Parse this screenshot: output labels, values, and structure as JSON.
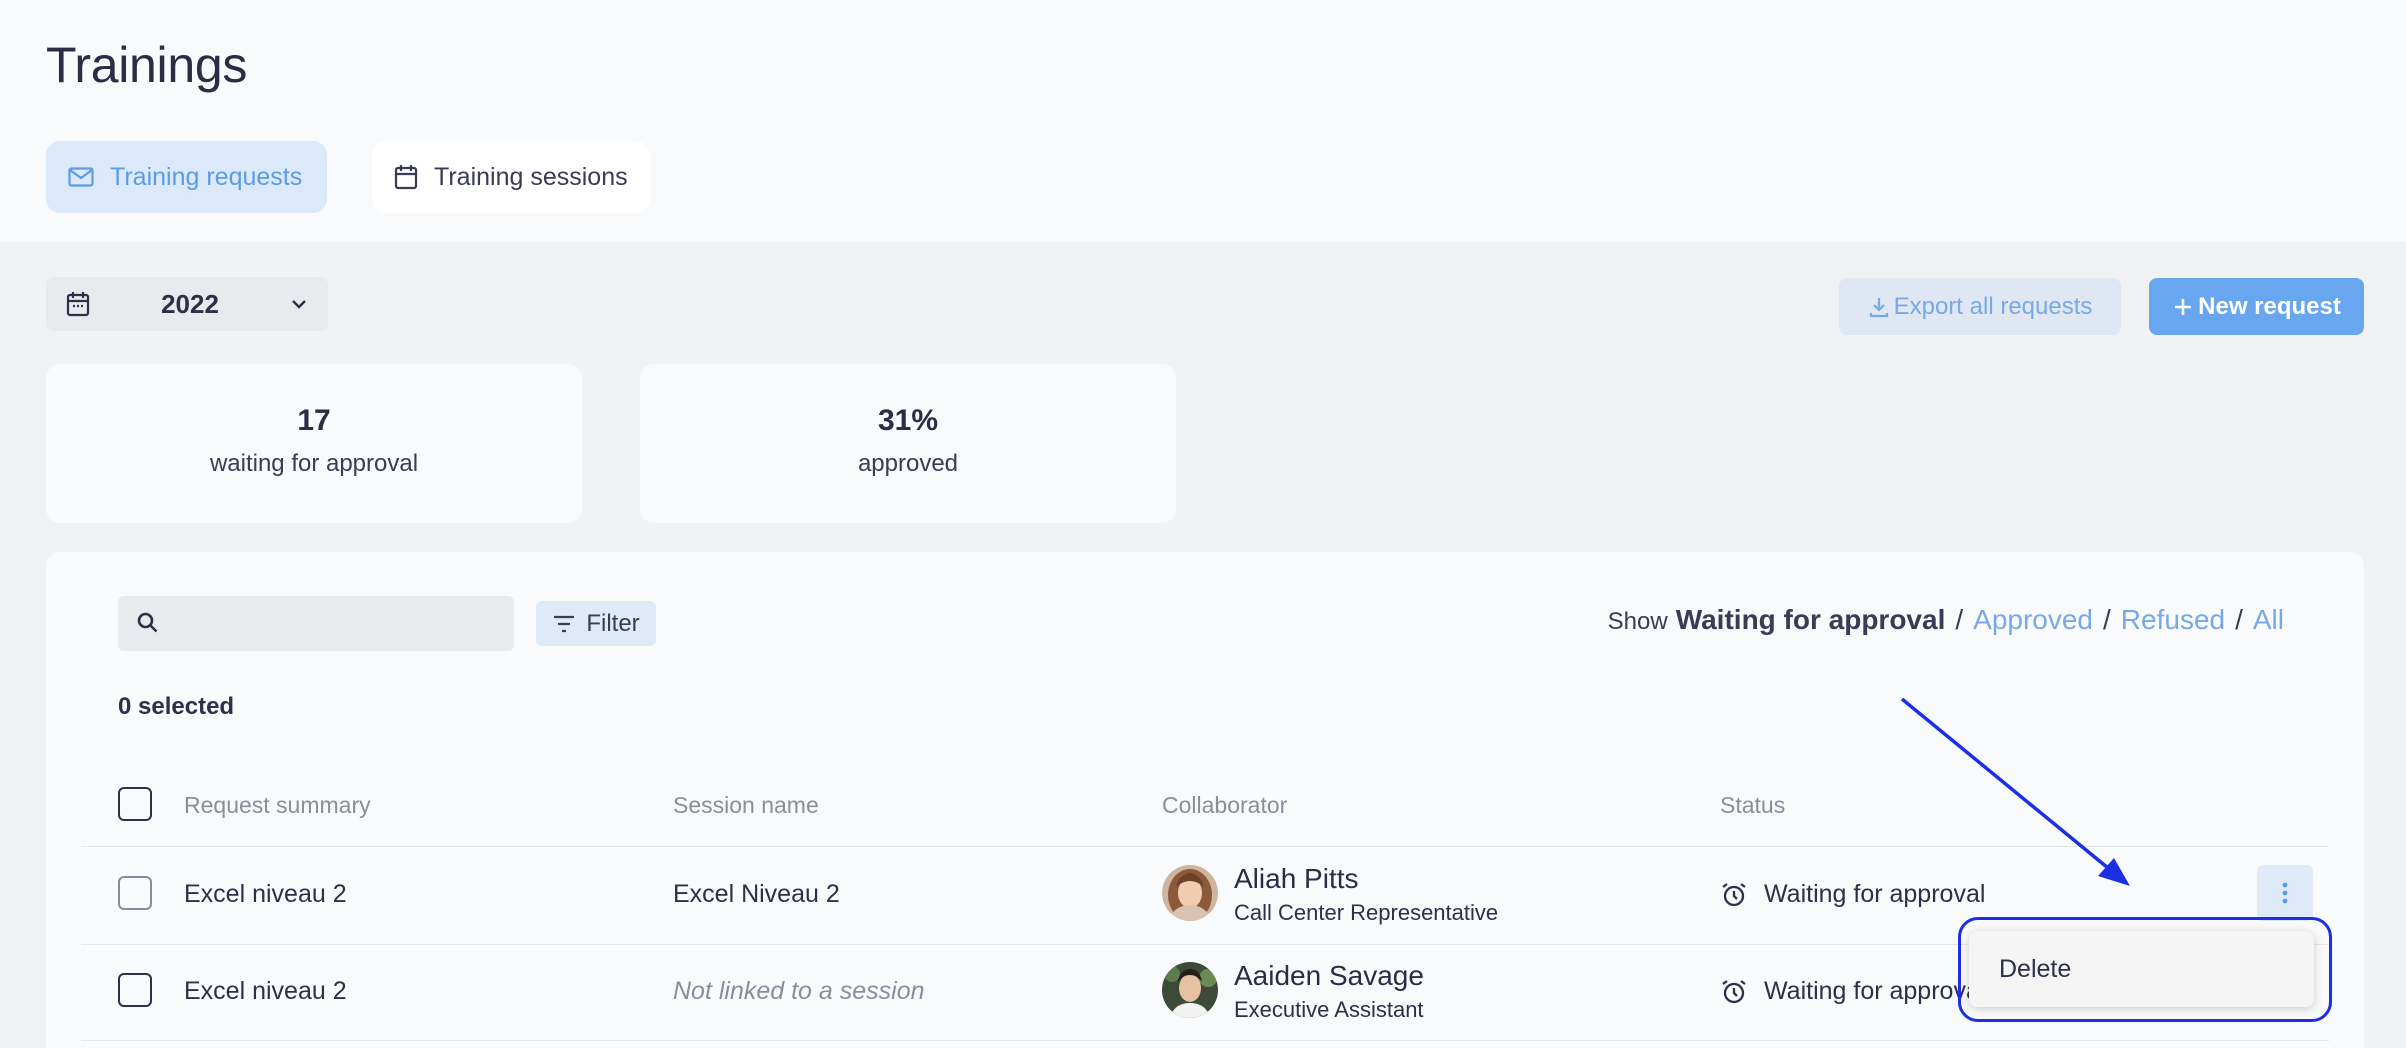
{
  "page": {
    "title": "Trainings"
  },
  "tabs": [
    {
      "label": "Training requests",
      "icon": "mail-icon",
      "active": true
    },
    {
      "label": "Training sessions",
      "icon": "calendar-icon",
      "active": false
    }
  ],
  "toolbar": {
    "year": "2022",
    "export_label": "Export all requests",
    "new_label": "New request"
  },
  "stats": [
    {
      "value": "17",
      "label": "waiting for approval"
    },
    {
      "value": "31%",
      "label": "approved"
    }
  ],
  "list": {
    "search_placeholder": "",
    "filter_label": "Filter",
    "show_label": "Show",
    "show_options": [
      {
        "label": "Waiting for approval",
        "active": true
      },
      {
        "label": "Approved",
        "active": false
      },
      {
        "label": "Refused",
        "active": false
      },
      {
        "label": "All",
        "active": false
      }
    ],
    "selected_count": "0 selected"
  },
  "table": {
    "columns": [
      "Request summary",
      "Session name",
      "Collaborator",
      "Status"
    ],
    "rows": [
      {
        "summary": "Excel niveau 2",
        "session": "Excel Niveau 2",
        "session_linked": true,
        "collaborator": "Aliah Pitts",
        "role": "Call Center Representative",
        "status": "Waiting for approval"
      },
      {
        "summary": "Excel niveau 2",
        "session": "Not linked to a session",
        "session_linked": false,
        "collaborator": "Aaiden Savage",
        "role": "Executive Assistant",
        "status": "Waiting for approval"
      }
    ]
  },
  "context_menu": {
    "items": [
      "Delete"
    ]
  },
  "colors": {
    "accent": "#68a6ef",
    "annotation": "#1a2fe6"
  }
}
